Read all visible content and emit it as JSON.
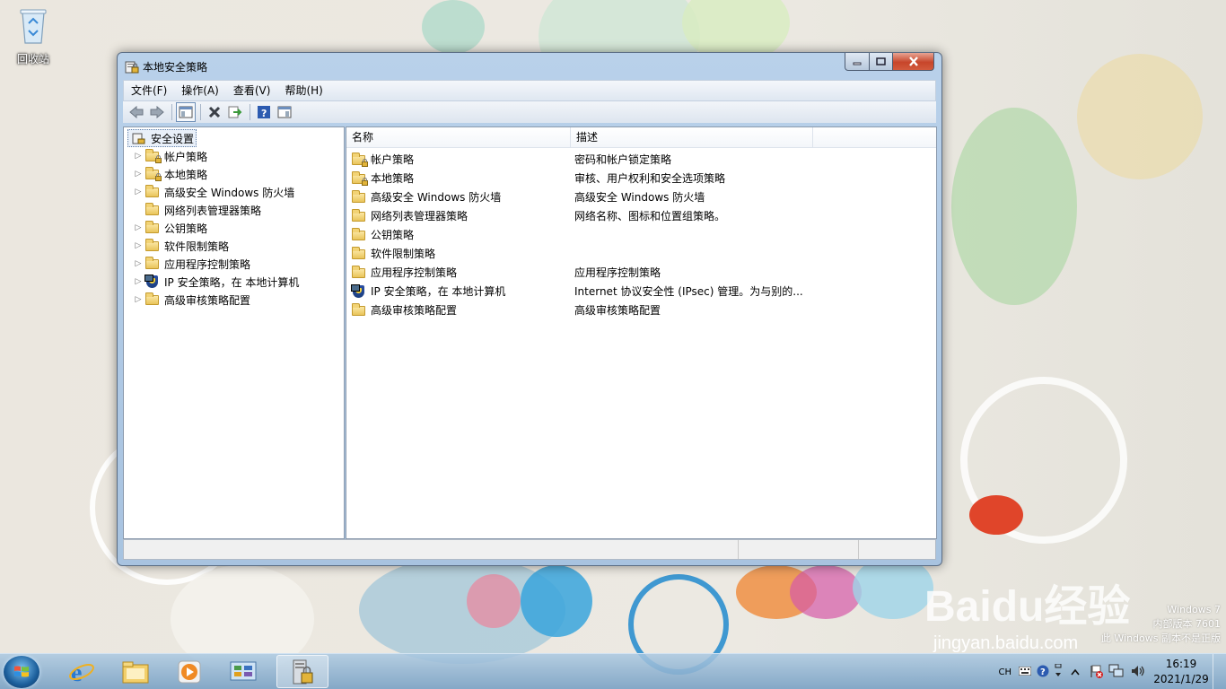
{
  "desktop": {
    "recycle_bin_label": "回收站"
  },
  "window": {
    "title": "本地安全策略",
    "menu": [
      "文件(F)",
      "操作(A)",
      "查看(V)",
      "帮助(H)"
    ]
  },
  "tree": {
    "root": "安全设置",
    "items": [
      {
        "label": "帐户策略",
        "icon": "folder-lock-icon",
        "expandable": true
      },
      {
        "label": "本地策略",
        "icon": "folder-lock-icon",
        "expandable": true
      },
      {
        "label": "高级安全 Windows 防火墙",
        "icon": "folder-icon",
        "expandable": true
      },
      {
        "label": "网络列表管理器策略",
        "icon": "folder-icon",
        "expandable": false
      },
      {
        "label": "公钥策略",
        "icon": "folder-icon",
        "expandable": true
      },
      {
        "label": "软件限制策略",
        "icon": "folder-icon",
        "expandable": true
      },
      {
        "label": "应用程序控制策略",
        "icon": "folder-icon",
        "expandable": true
      },
      {
        "label": "IP 安全策略，在 本地计算机",
        "icon": "ip-security-icon",
        "expandable": true
      },
      {
        "label": "高级审核策略配置",
        "icon": "folder-icon",
        "expandable": true
      }
    ]
  },
  "list": {
    "columns": [
      "名称",
      "描述"
    ],
    "rows": [
      {
        "name": "帐户策略",
        "desc": "密码和帐户锁定策略",
        "icon": "folder-lock-icon"
      },
      {
        "name": "本地策略",
        "desc": "审核、用户权利和安全选项策略",
        "icon": "folder-lock-icon"
      },
      {
        "name": "高级安全 Windows 防火墙",
        "desc": "高级安全 Windows 防火墙",
        "icon": "folder-icon"
      },
      {
        "name": "网络列表管理器策略",
        "desc": "网络名称、图标和位置组策略。",
        "icon": "folder-icon"
      },
      {
        "name": "公钥策略",
        "desc": "",
        "icon": "folder-icon"
      },
      {
        "name": "软件限制策略",
        "desc": "",
        "icon": "folder-icon"
      },
      {
        "name": "应用程序控制策略",
        "desc": "应用程序控制策略",
        "icon": "folder-icon"
      },
      {
        "name": "IP 安全策略，在 本地计算机",
        "desc": "Internet 协议安全性 (IPsec) 管理。为与别的...",
        "icon": "ip-security-icon"
      },
      {
        "name": "高级审核策略配置",
        "desc": "高级审核策略配置",
        "icon": "folder-icon"
      }
    ]
  },
  "tray": {
    "language": "CH",
    "time": "16:19",
    "date": "2021/1/29"
  },
  "watermark": {
    "line1": "Windows 7",
    "line2": "内部版本 7601",
    "line3": "此 Windows 副本不是正版",
    "baidu": "Baidu经验",
    "baidu_url": "jingyan.baidu.com"
  },
  "colors": {
    "selection": "#e9f0f9",
    "window_frame": "#b9d1ea",
    "taskbar": "#8fb3d2"
  }
}
